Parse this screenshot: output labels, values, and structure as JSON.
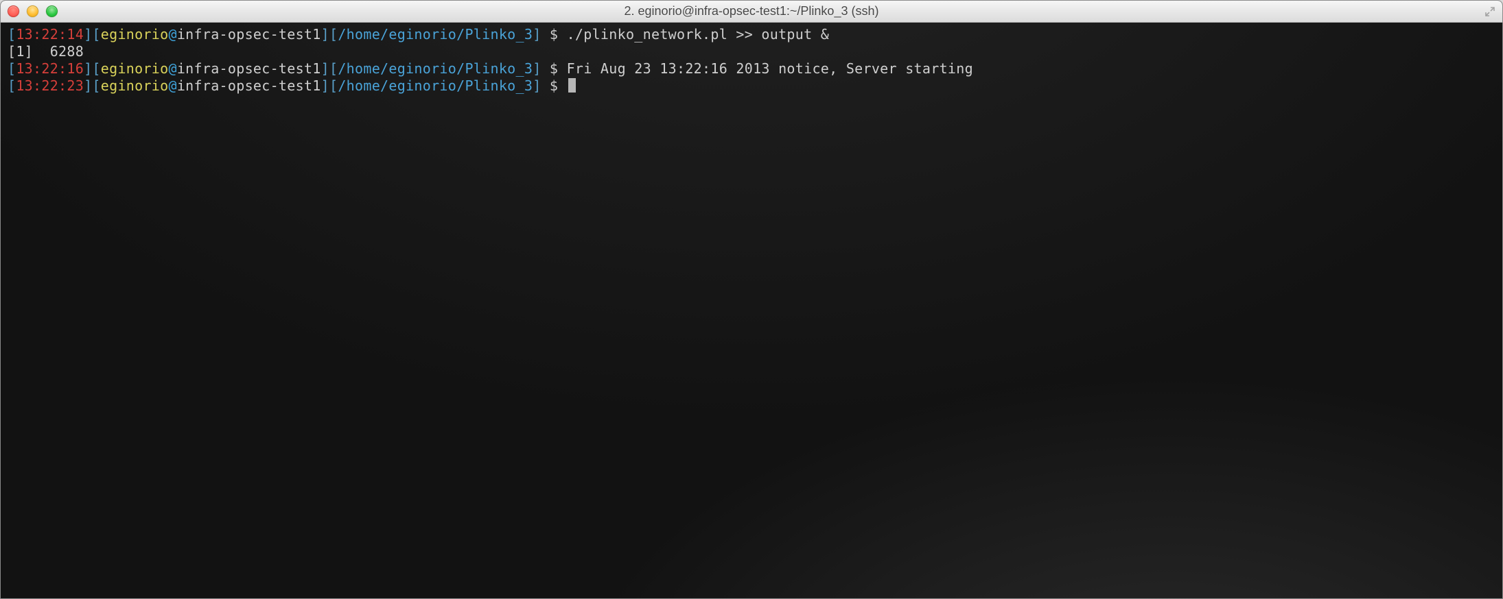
{
  "window": {
    "title": "2. eginorio@infra-opsec-test1:~/Plinko_3 (ssh)"
  },
  "lines": [
    {
      "time": "13:22:14",
      "user": "eginorio",
      "host": "infra-opsec-test1",
      "path": "/home/eginorio/Plinko_3",
      "prompt": "$",
      "command": "./plinko_network.pl >> output &"
    },
    {
      "raw": "[1]  6288"
    },
    {
      "time": "13:22:16",
      "user": "eginorio",
      "host": "infra-opsec-test1",
      "path": "/home/eginorio/Plinko_3",
      "prompt": "$",
      "command": "Fri Aug 23 13:22:16 2013 notice, Server starting"
    },
    {
      "raw": ""
    },
    {
      "time": "13:22:23",
      "user": "eginorio",
      "host": "infra-opsec-test1",
      "path": "/home/eginorio/Plinko_3",
      "prompt": "$",
      "command": "",
      "cursor": true
    }
  ]
}
